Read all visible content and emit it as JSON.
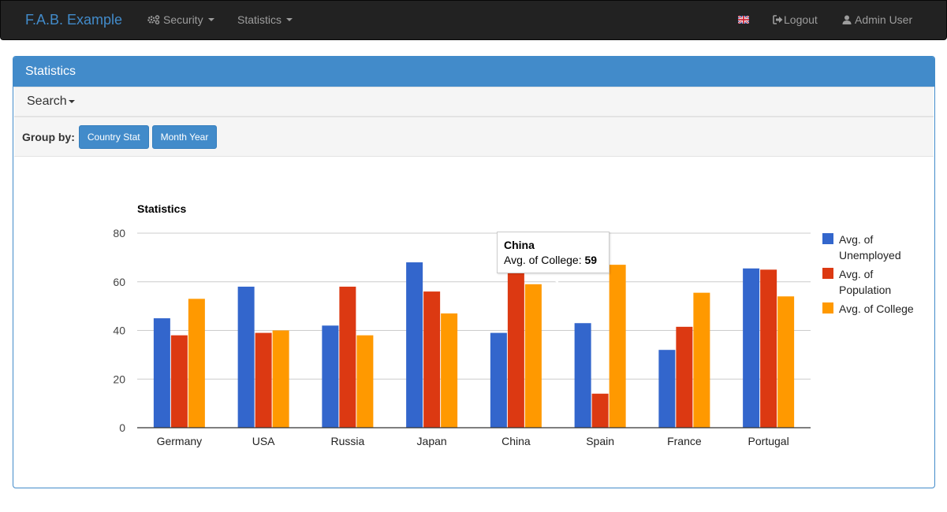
{
  "navbar": {
    "brand": "F.A.B. Example",
    "menus": [
      {
        "label": "Security",
        "icon": "gears-icon"
      },
      {
        "label": "Statistics",
        "icon": ""
      }
    ],
    "right": {
      "language_icon": "uk-flag-icon",
      "logout_label": "Logout",
      "user_label": "Admin User"
    }
  },
  "panel": {
    "title": "Statistics",
    "search_label": "Search",
    "group_by_label": "Group by:",
    "group_buttons": [
      "Country Stat",
      "Month Year"
    ]
  },
  "tooltip": {
    "title": "China",
    "label": "Avg. of College: ",
    "value": "59"
  },
  "colors": {
    "accent": "#428bca",
    "navbar": "#222222",
    "series": [
      "#3366cc",
      "#dc3912",
      "#ff9900"
    ]
  },
  "chart_data": {
    "type": "bar",
    "title": "Statistics",
    "xlabel": "",
    "ylabel": "",
    "ylim": [
      0,
      80
    ],
    "yticks": [
      0,
      20,
      40,
      60,
      80
    ],
    "grid": true,
    "legend": "right",
    "categories": [
      "Germany",
      "USA",
      "Russia",
      "Japan",
      "China",
      "Spain",
      "France",
      "Portugal"
    ],
    "series": [
      {
        "name": "Avg. of Unemployed",
        "values": [
          45,
          58,
          42,
          68,
          39,
          43,
          32,
          65.5
        ]
      },
      {
        "name": "Avg. of Population",
        "values": [
          38,
          39,
          58,
          56,
          70,
          14,
          41.5,
          65
        ]
      },
      {
        "name": "Avg. of College",
        "values": [
          53,
          40,
          38,
          47,
          59,
          67,
          55.5,
          54
        ]
      }
    ]
  }
}
